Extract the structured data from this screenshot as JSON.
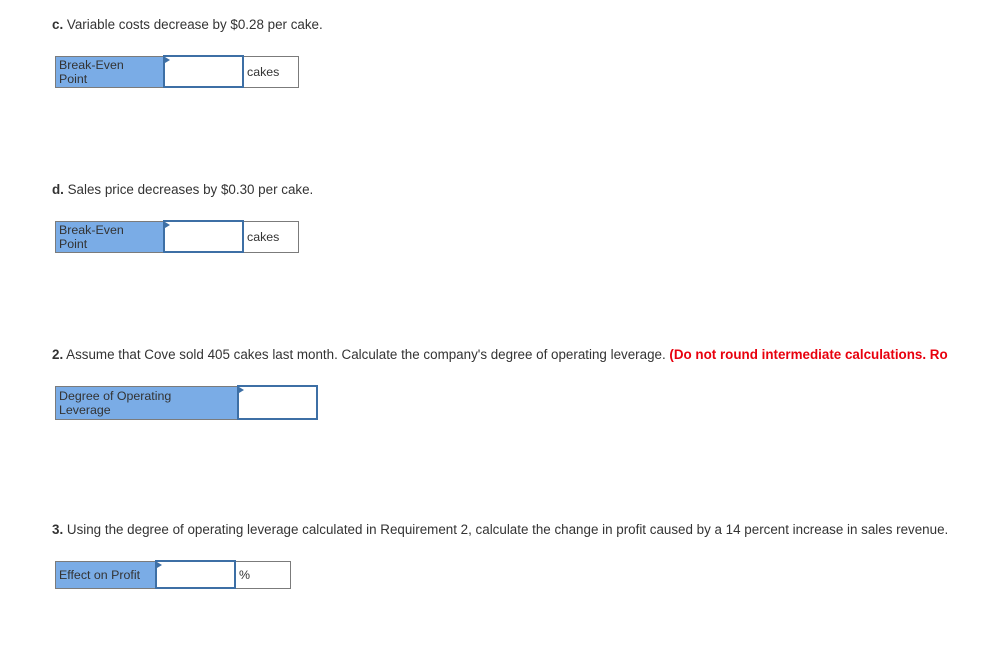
{
  "part_c": {
    "prefix": "c.",
    "text": " Variable costs decrease by $0.28 per cake.",
    "row_label_line1": "Break-Even",
    "row_label_line2": "Point",
    "input_value": "",
    "unit": "cakes"
  },
  "part_d": {
    "prefix": "d.",
    "text": " Sales price decreases by $0.30 per cake.",
    "row_label_line1": "Break-Even",
    "row_label_line2": "Point",
    "input_value": "",
    "unit": "cakes"
  },
  "req2": {
    "prefix": "2.",
    "text": " Assume that Cove sold 405 cakes last month. Calculate the company's degree of operating leverage. ",
    "warning": "(Do not round intermediate calculations. Ro",
    "row_label_line1": "Degree of Operating",
    "row_label_line2": "Leverage",
    "input_value": ""
  },
  "req3": {
    "prefix": "3.",
    "text": " Using the degree of operating leverage calculated in Requirement 2, calculate the change in profit caused by a 14 percent increase in sales revenue.",
    "row_label": "Effect on Profit",
    "input_value": "",
    "unit": "%"
  },
  "colors": {
    "header_fill": "#7aace6",
    "input_border": "#3d6fa5",
    "warning_text": "#e8000d"
  }
}
